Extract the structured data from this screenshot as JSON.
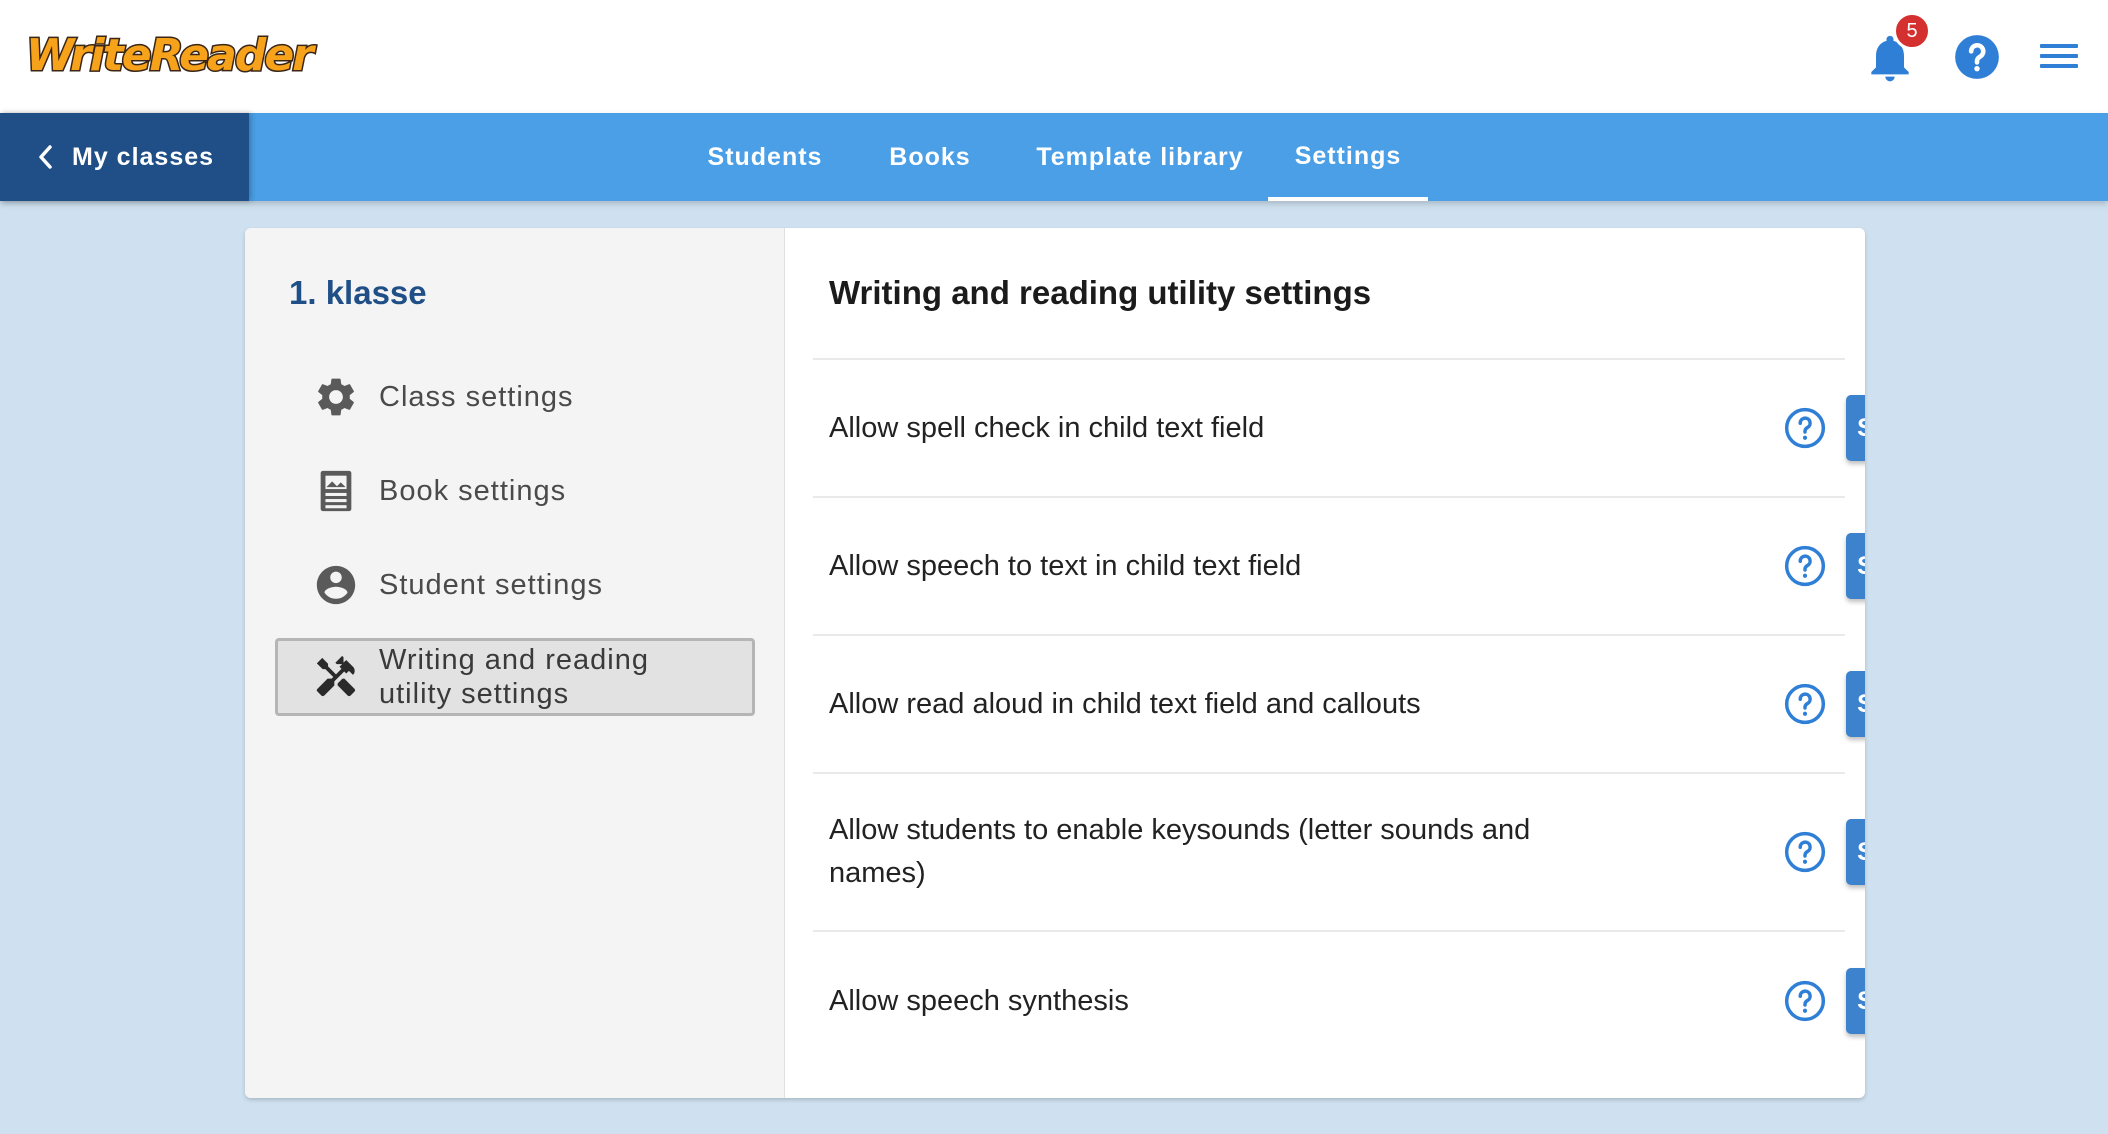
{
  "header": {
    "logo_text": "WriteReader",
    "notification_count": "5",
    "colors": {
      "logo": "#f7a21b",
      "star": "#f5a83a",
      "badge": "#d3302f",
      "icons": "#2f7fd6"
    }
  },
  "nav": {
    "back_label": "My classes",
    "tabs": [
      {
        "label": "Students"
      },
      {
        "label": "Books"
      },
      {
        "label": "Template library"
      },
      {
        "label": "Settings",
        "active": true
      }
    ],
    "colors": {
      "bar": "#4a9fe6",
      "back": "#1f4f86"
    }
  },
  "sidebar": {
    "class_name": "1. klasse",
    "items": [
      {
        "label": "Class settings",
        "icon": "gear-icon"
      },
      {
        "label": "Book settings",
        "icon": "book-icon"
      },
      {
        "label": "Student settings",
        "icon": "account-circle-icon"
      },
      {
        "label_line1": "Writing and reading",
        "label_line2": "utility settings",
        "icon": "tools-icon",
        "active": true
      }
    ]
  },
  "main": {
    "title": "Writing and reading utility settings",
    "button_color": "#3c82cc",
    "settings": [
      {
        "label": "Allow spell check in child text field",
        "button": "Select students"
      },
      {
        "label": "Allow speech to text in child text field",
        "button": "Select students"
      },
      {
        "label": "Allow read aloud in child text field and callouts",
        "button": "Select students"
      },
      {
        "label": "Allow students to enable keysounds (letter sounds and names)",
        "button": "Select students"
      },
      {
        "label": "Allow speech synthesis",
        "button": "Select students"
      }
    ]
  }
}
